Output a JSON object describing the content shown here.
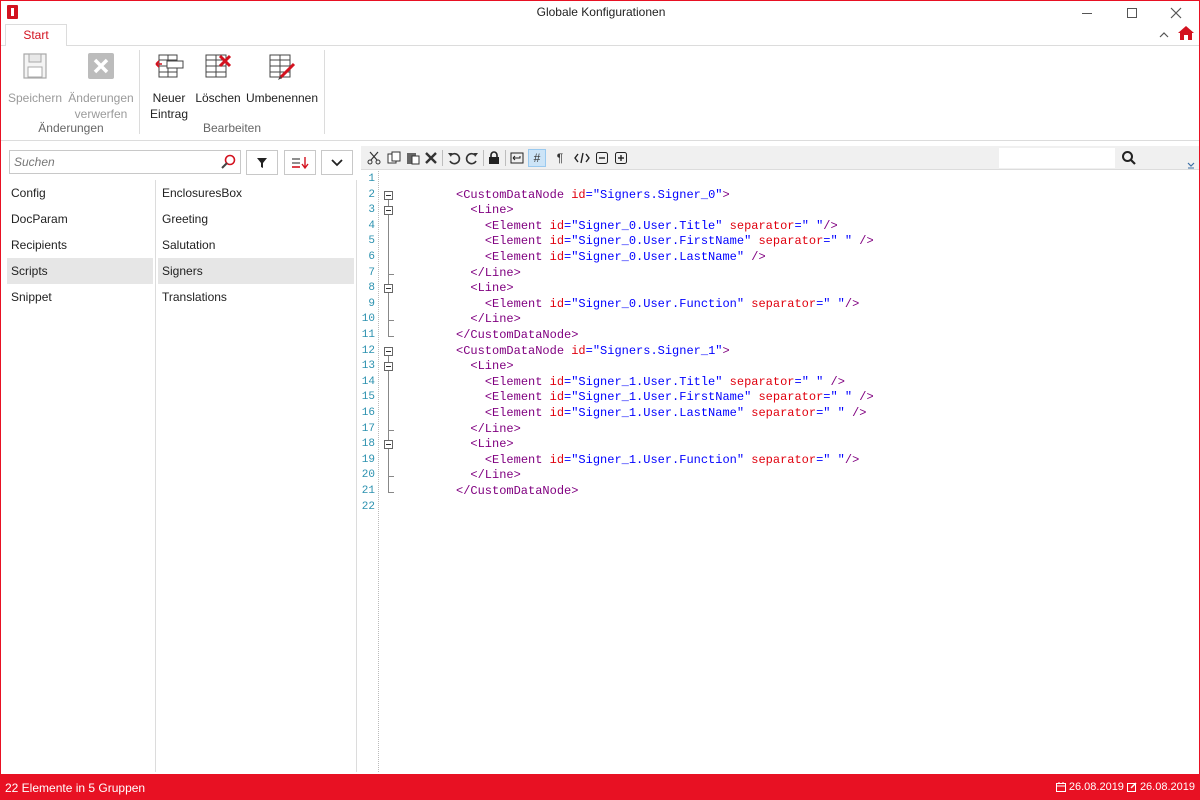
{
  "window": {
    "title": "Globale Konfigurationen"
  },
  "ribbon": {
    "tab": "Start",
    "groups": [
      {
        "label": "Änderungen",
        "buttons": [
          {
            "label": "Speichern",
            "icon": "save-icon",
            "enabled": false
          },
          {
            "label": "Änderungen verwerfen",
            "line1": "Änderungen",
            "line2": "verwerfen",
            "icon": "discard-icon",
            "enabled": false
          }
        ]
      },
      {
        "label": "Bearbeiten",
        "buttons": [
          {
            "label": "Neuer Eintrag",
            "line1": "Neuer",
            "line2": "Eintrag",
            "icon": "new-entry-icon",
            "enabled": true
          },
          {
            "label": "Löschen",
            "icon": "delete-icon",
            "enabled": true
          },
          {
            "label": "Umbenennen",
            "icon": "rename-icon",
            "enabled": true
          }
        ]
      }
    ]
  },
  "search": {
    "placeholder": "Suchen",
    "value": ""
  },
  "groups": {
    "items": [
      "Config",
      "DocParam",
      "Recipients",
      "Scripts",
      "Snippet"
    ],
    "selected": "Scripts"
  },
  "entries": {
    "items": [
      "EnclosuresBox",
      "Greeting",
      "Salutation",
      "Signers",
      "Translations"
    ],
    "selected": "Signers"
  },
  "editor": {
    "search_value": "",
    "line_numbers": [
      "1",
      "2",
      "3",
      "4",
      "5",
      "6",
      "7",
      "8",
      "9",
      "10",
      "11",
      "12",
      "13",
      "14",
      "15",
      "16",
      "17",
      "18",
      "19",
      "20",
      "21",
      "22"
    ],
    "lines": [
      "",
      "<CustomDataNode id=\"Signers.Signer_0\">",
      "  <Line>",
      "    <Element id=\"Signer_0.User.Title\" separator=\" \"/>",
      "    <Element id=\"Signer_0.User.FirstName\" separator=\" \" />",
      "    <Element id=\"Signer_0.User.LastName\" />",
      "  </Line>",
      "  <Line>",
      "    <Element id=\"Signer_0.User.Function\" separator=\" \"/>",
      "  </Line>",
      "</CustomDataNode>",
      "<CustomDataNode id=\"Signers.Signer_1\">",
      "  <Line>",
      "    <Element id=\"Signer_1.User.Title\" separator=\" \" />",
      "    <Element id=\"Signer_1.User.FirstName\" separator=\" \" />",
      "    <Element id=\"Signer_1.User.LastName\" separator=\" \" />",
      "  </Line>",
      "  <Line>",
      "    <Element id=\"Signer_1.User.Function\" separator=\" \"/>",
      "  </Line>",
      "</CustomDataNode>",
      ""
    ]
  },
  "status": {
    "summary": "22 Elemente in 5 Gruppen",
    "created_date": "26.08.2019",
    "modified_date": "26.08.2019"
  },
  "colors": {
    "accent": "#e81123",
    "tag": "#800080",
    "attribute": "#e0000e",
    "value": "#0000ff"
  }
}
